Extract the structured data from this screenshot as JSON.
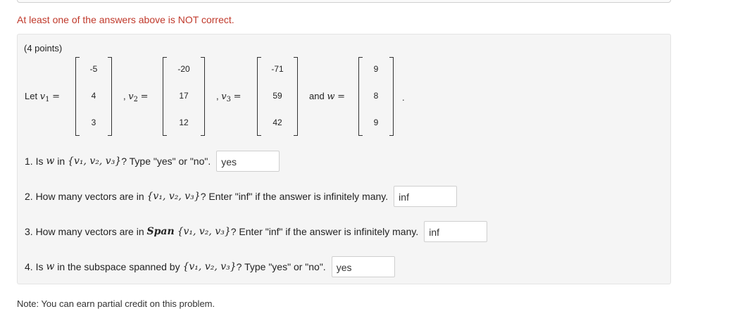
{
  "warning": "At least one of the answers above is NOT correct.",
  "points": "(4 points)",
  "statement": {
    "let": "Let",
    "v1_name": "v",
    "v1_sub": "1",
    "v2_name": "v",
    "v2_sub": "2",
    "v3_name": "v",
    "v3_sub": "3",
    "w_name": "w",
    "and": "and",
    "equals": "=",
    "comma": ",",
    "period": "."
  },
  "vectors": {
    "v1": [
      "-5",
      "4",
      "3"
    ],
    "v2": [
      "-20",
      "17",
      "12"
    ],
    "v3": [
      "-71",
      "59",
      "42"
    ],
    "w": [
      "9",
      "8",
      "9"
    ]
  },
  "questions": [
    {
      "prefix": "1. Is",
      "mid": "in",
      "set": "{v₁, v₂, v₃}",
      "suffix": "? Type \"yes\" or \"no\".",
      "answer": "yes"
    },
    {
      "prefix": "2. How many vectors are in",
      "set": "{v₁, v₂, v₃}",
      "suffix": "? Enter \"inf\" if the answer is infinitely many.",
      "answer": "inf"
    },
    {
      "prefix": "3. How many vectors are in",
      "span": "Span",
      "set": "{v₁, v₂, v₃}",
      "suffix": "? Enter \"inf\" if the answer is infinitely many.",
      "answer": "inf"
    },
    {
      "prefix": "4. Is",
      "mid": "in the subspace spanned by",
      "set": "{v₁, v₂, v₃}",
      "suffix": "? Type \"yes\" or \"no\".",
      "answer": "yes"
    }
  ],
  "note": "Note: You can earn partial credit on this problem."
}
